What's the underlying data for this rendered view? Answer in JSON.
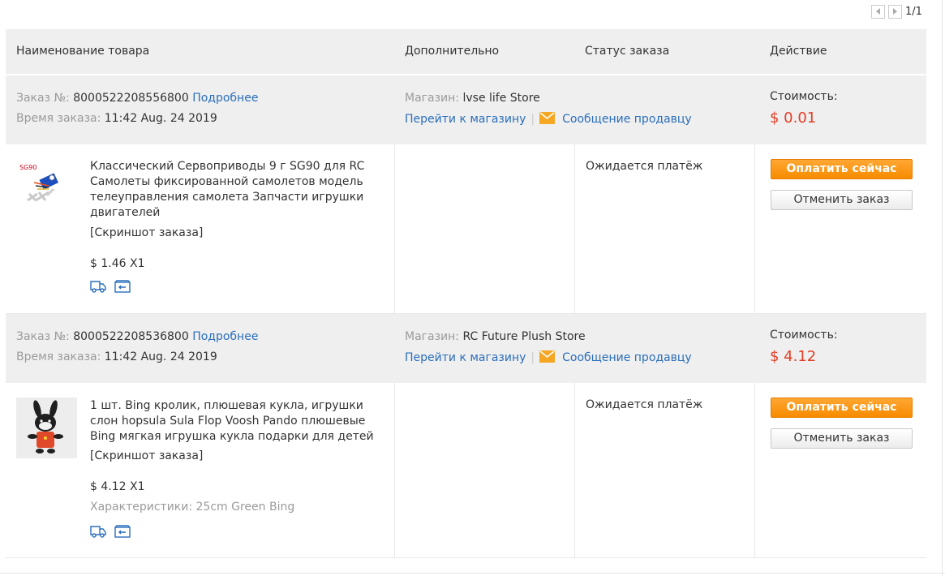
{
  "pager": {
    "text": "1/1"
  },
  "table_header": {
    "col_product": "Наименование товара",
    "col_extra": "Дополнительно",
    "col_status": "Статус заказа",
    "col_action": "Действие"
  },
  "labels": {
    "order_no": "Заказ №:",
    "order_time": "Время заказа:",
    "details": "Подробнее",
    "store": "Магазин:",
    "goto_store": "Перейти к магазину",
    "message_seller": "Сообщение продавцу",
    "cost": "Стоимость:",
    "snapshot": "[Скриншот заказа]",
    "pay_now": "Оплатить сейчас",
    "cancel_order": "Отменить заказ",
    "separator": "|"
  },
  "orders": [
    {
      "number": "8000522208556800",
      "time": "11:42 Aug. 24 2019",
      "store_name": "lvse life Store",
      "cost": "$ 0.01",
      "product_title": "Классический Сервоприводы 9 г SG90 для RC Самолеты фиксированной самолетов модель телеуправления самолета Запчасти игрушки двигателей",
      "thumb_label": "SG90",
      "unit_price": "$ 1.46 X1",
      "attributes": "",
      "status": "Ожидается платёж"
    },
    {
      "number": "8000522208536800",
      "time": "11:42 Aug. 24 2019",
      "store_name": "RC Future Plush Store",
      "cost": "$ 4.12",
      "product_title": "1 шт. Bing кролик, плюшевая кукла, игрушки слон hopsula Sula Flop Voosh Pando плюшевые Bing мягкая игрушка кукла подарки для детей",
      "unit_price": "$ 4.12 X1",
      "attributes": "Характеристики: 25cm Green Bing",
      "status": "Ожидается платёж"
    }
  ],
  "colors": {
    "price": "#e33e26",
    "link": "#2a6ebb",
    "pay_button": "#f78b00",
    "header_bg": "#efefef",
    "label_gray": "#9b9b9b"
  },
  "icons": [
    "chevron-left-icon",
    "chevron-right-icon",
    "mail-icon",
    "delivery-truck-icon",
    "return-box-icon"
  ]
}
